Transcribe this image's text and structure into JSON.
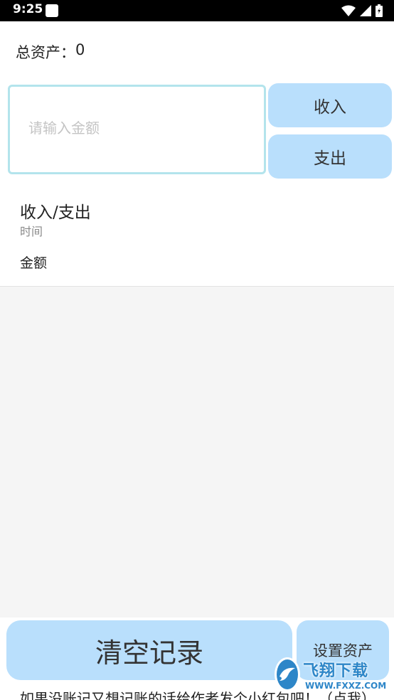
{
  "status_bar": {
    "time": "9:25",
    "icons": [
      "notification-icon",
      "wifi-icon",
      "signal-icon",
      "battery-icon"
    ]
  },
  "assets": {
    "label": "总资产：",
    "value": "0"
  },
  "amount_input": {
    "placeholder": "请输入金额",
    "value": ""
  },
  "buttons": {
    "income": "收入",
    "expense": "支出",
    "clear": "清空记录",
    "set_assets": "设置资产"
  },
  "record_header": {
    "type": "收入/支出",
    "time": "时间",
    "amount": "金额"
  },
  "footer": {
    "tip": "如果没账记又想记账的话给作者发个小红包吧！（点我）"
  },
  "watermark": {
    "title": "飞翔下载",
    "url": "WWW.FXXZ.COM"
  },
  "colors": {
    "button_bg": "#b9dffc",
    "input_border": "#b3e4ec",
    "list_bg": "#f5f5f5"
  }
}
